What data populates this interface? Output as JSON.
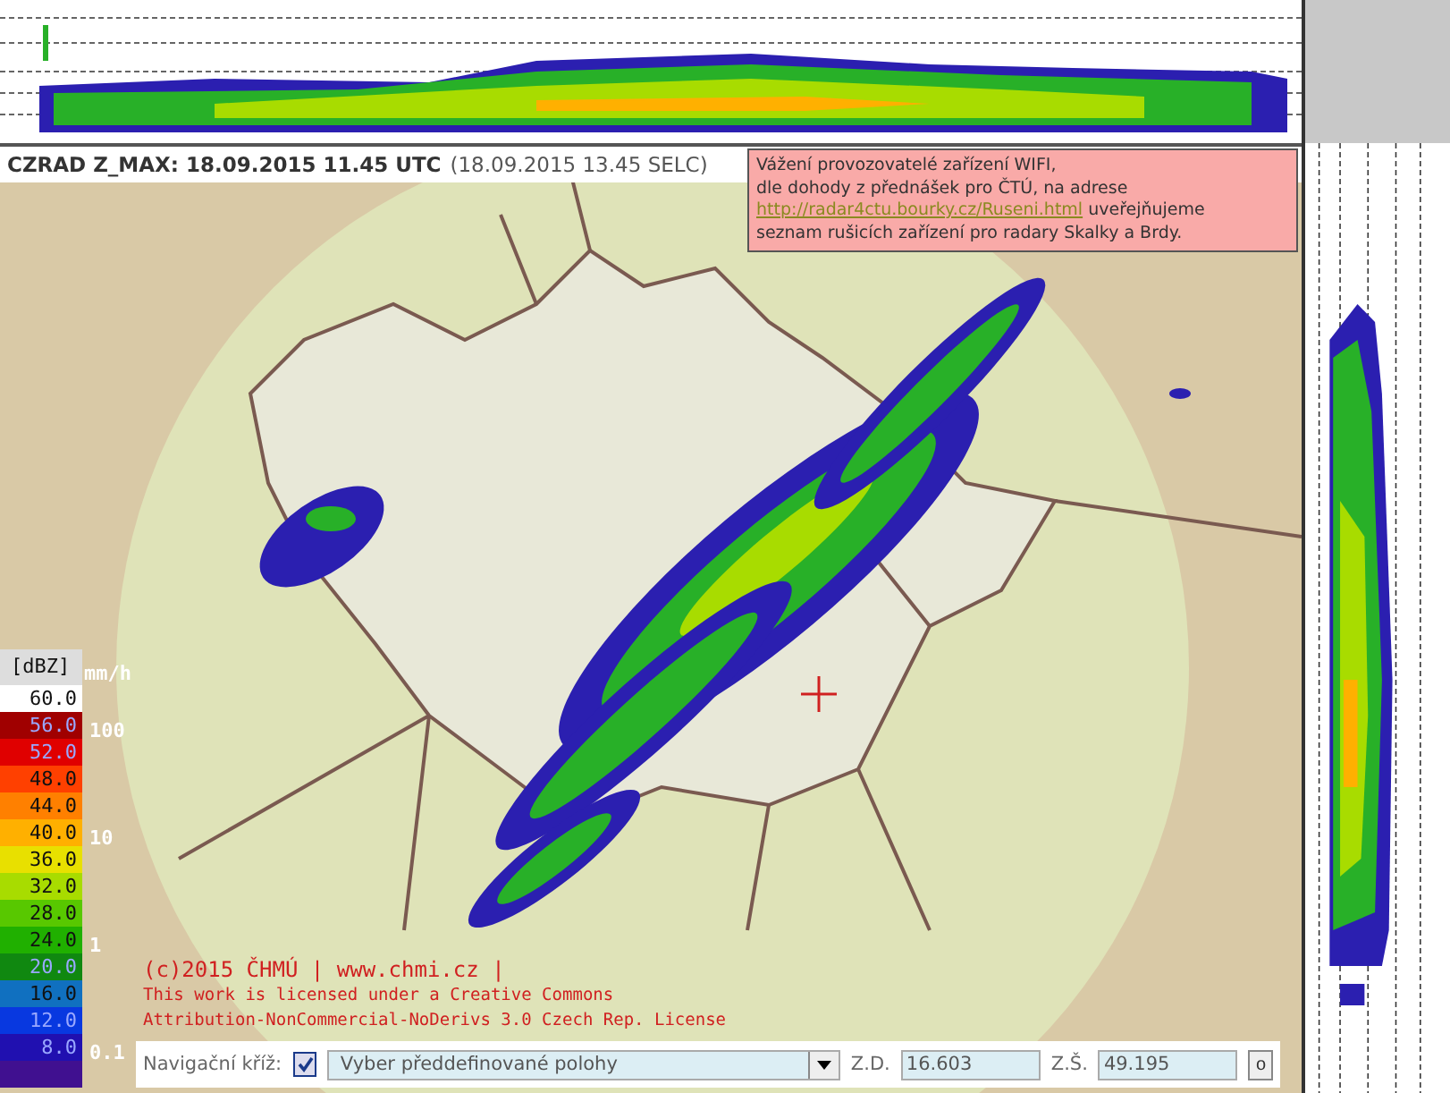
{
  "header": {
    "title": "CZRAD Z_MAX: 18.09.2015 11.45 UTC",
    "local_time": "(18.09.2015 13.45 SELC)"
  },
  "notice": {
    "lines": [
      "Vážení provozovatelé zařízení WIFI,",
      "dle dohody z přednášek pro ČTÚ, na adrese"
    ],
    "link": "http://radar4ctu.bourky.cz/Ruseni.html",
    "after_link": "uveřejňujeme",
    "last_line": "seznam rušicích zařízení pro radary Skalky a Brdy."
  },
  "legend": {
    "unit": "[dBZ]",
    "items": [
      {
        "label": "60.0",
        "color": "#ffffff"
      },
      {
        "label": "56.0",
        "color": "#a00000"
      },
      {
        "label": "52.0",
        "color": "#e00000"
      },
      {
        "label": "48.0",
        "color": "#ff4000"
      },
      {
        "label": "44.0",
        "color": "#ff8000"
      },
      {
        "label": "40.0",
        "color": "#ffb000"
      },
      {
        "label": "36.0",
        "color": "#e8e000"
      },
      {
        "label": "32.0",
        "color": "#a8dc00"
      },
      {
        "label": "28.0",
        "color": "#58c800"
      },
      {
        "label": "24.0",
        "color": "#20b000"
      },
      {
        "label": "20.0",
        "color": "#108810"
      },
      {
        "label": "16.0",
        "color": "#1070c0"
      },
      {
        "label": "12.0",
        "color": "#0838e0"
      },
      {
        "label": "8.0",
        "color": "#2010b0"
      }
    ]
  },
  "rain_scale": {
    "unit": "mm/h",
    "ticks": [
      "100",
      "10",
      "1",
      "0.1"
    ]
  },
  "copyright": {
    "line": "(c)2015 ČHMÚ | www.chmi.cz |",
    "license": [
      "This work is licensed under a Creative Commons",
      "Attribution-NonCommercial-NoDerivs 3.0 Czech Rep. License"
    ]
  },
  "nav": {
    "label": "Navigační kříž:",
    "checked": true,
    "select": "Vyber předdefinované polohy",
    "lon_label": "Z.D.",
    "lon": "16.603",
    "lat_label": "Z.Š.",
    "lat": "49.195",
    "button": "o"
  }
}
